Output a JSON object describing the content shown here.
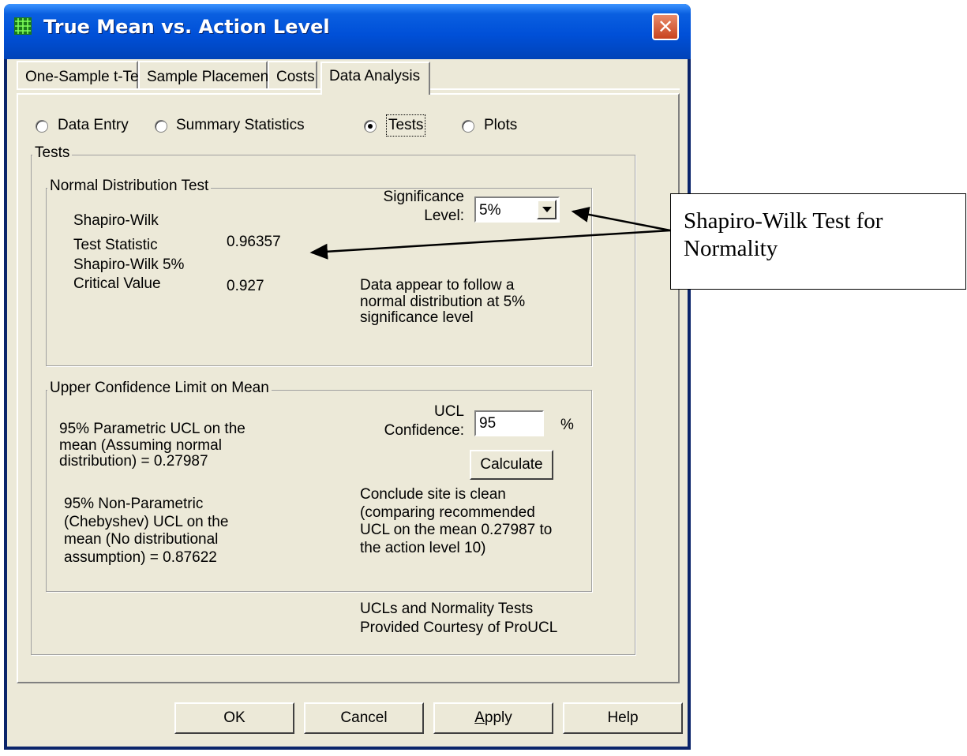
{
  "window": {
    "title": "True Mean vs. Action Level",
    "close_glyph": "✕"
  },
  "tabs": [
    {
      "label": "One-Sample t-Test",
      "selected": false
    },
    {
      "label": "Sample Placement",
      "selected": false
    },
    {
      "label": "Costs",
      "selected": false
    },
    {
      "label": "Data Analysis",
      "selected": true
    }
  ],
  "view_options": [
    {
      "label": "Data Entry",
      "selected": false
    },
    {
      "label": "Summary Statistics",
      "selected": false
    },
    {
      "label": "Tests",
      "selected": true
    },
    {
      "label": "Plots",
      "selected": false
    }
  ],
  "tests_group": {
    "label": "Tests",
    "normal_test": {
      "label": "Normal Distribution Test",
      "statistic_label_line1": "Shapiro-Wilk",
      "statistic_label_line2": "Test Statistic",
      "statistic_value": "0.96357",
      "critical_label_line1": "Shapiro-Wilk 5%",
      "critical_label_line2": "Critical Value",
      "critical_value": "0.927",
      "significance_label_line1": "Significance",
      "significance_label_line2": "Level:",
      "significance_value": "5%",
      "conclusion_line1": "Data appear to follow a",
      "conclusion_line2": "normal distribution at 5%",
      "conclusion_line3": "significance level"
    },
    "ucl": {
      "label": "Upper Confidence Limit on Mean",
      "parametric_line1": "95% Parametric UCL on the",
      "parametric_line2": "mean (Assuming normal",
      "parametric_line3": "distribution) = 0.27987",
      "nonparametric_line1": "95% Non-Parametric",
      "nonparametric_line2": "(Chebyshev) UCL on the",
      "nonparametric_line3": "mean (No distributional",
      "nonparametric_line4": "assumption) = 0.87622",
      "confidence_label_line1": "UCL",
      "confidence_label_line2": "Confidence:",
      "confidence_value": "95",
      "percent_sign": "%",
      "calculate_label": "Calculate",
      "conclusion_line1": "Conclude site is clean",
      "conclusion_line2": "(comparing recommended",
      "conclusion_line3": "UCL on the mean 0.27987 to",
      "conclusion_line4": "the action level 10)"
    },
    "credit_line1": "UCLs and Normality Tests",
    "credit_line2": "Provided Courtesy of ProUCL"
  },
  "buttons": {
    "ok": "OK",
    "cancel": "Cancel",
    "apply_mnemonic": "A",
    "apply_rest": "pply",
    "help": "Help"
  },
  "callout": {
    "line1": "Shapiro-Wilk Test for",
    "line2": "Normality"
  },
  "colors": {
    "title_bar": "#0050d8",
    "dialog_face": "#ece9d8",
    "result_text": "#c00000"
  }
}
